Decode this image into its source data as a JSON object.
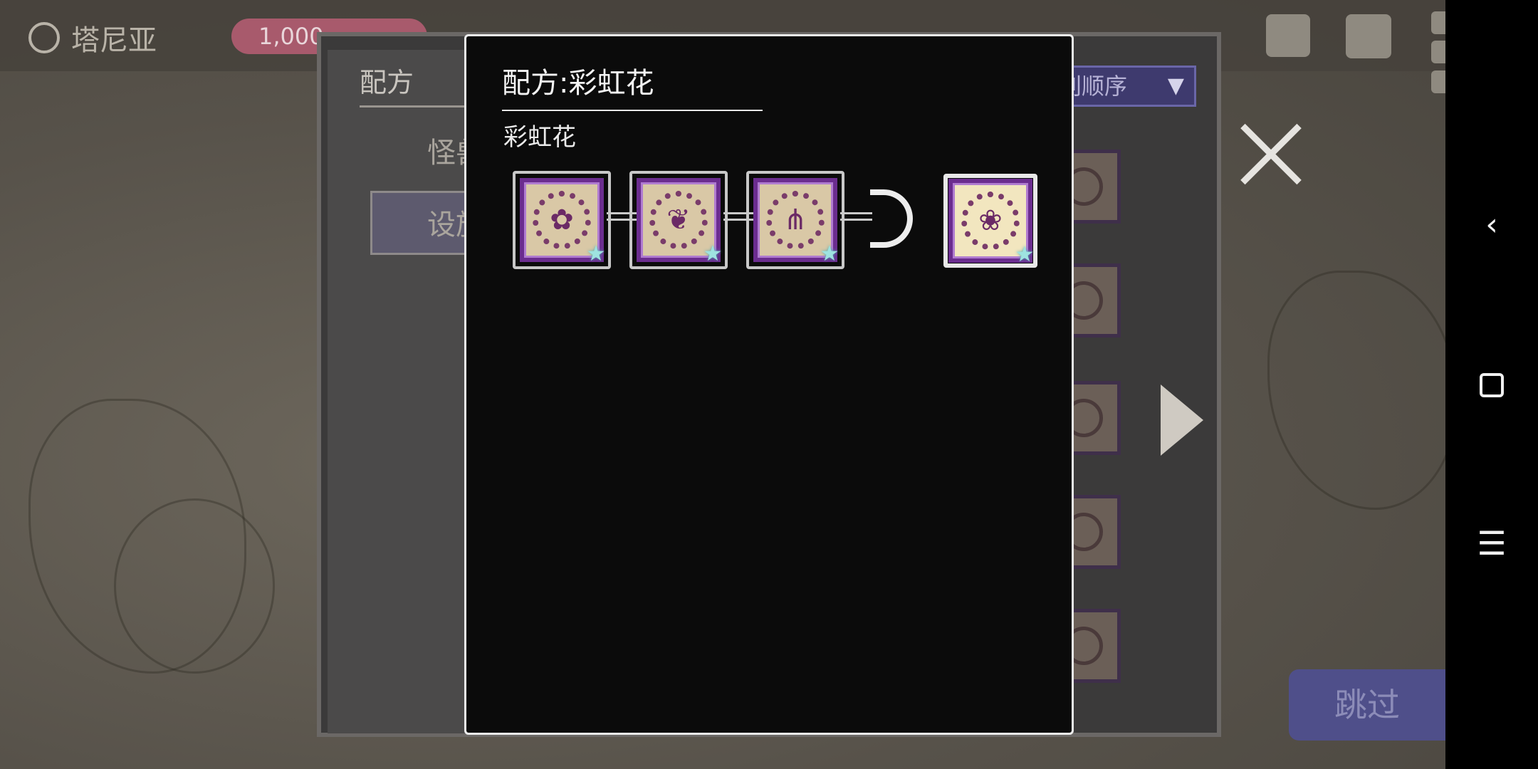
{
  "window": {
    "width": 2160,
    "height": 1080
  },
  "topbar": {
    "town_name": "塔尼亚",
    "gold": "1,000",
    "town_icon": "cauldron-icon",
    "icons": [
      "book-icon",
      "document-icon",
      "grid-menu-icon"
    ]
  },
  "book": {
    "tab_title": "配方",
    "tabs": [
      {
        "label": "怪兽",
        "selected": false
      },
      {
        "label": "设施",
        "selected": true
      }
    ],
    "sort_label": "按级别顺序",
    "sort_icon": "sort-icon",
    "sort_arrow": "▼",
    "skip_label": "跳过",
    "close_icon": "close-icon"
  },
  "modal": {
    "title": "配方:彩虹花",
    "subtitle": "彩虹花",
    "ingredients": [
      {
        "icon": "flower-icon",
        "glyph": "✿"
      },
      {
        "icon": "leaf-icon",
        "glyph": "❦"
      },
      {
        "icon": "grass-icon",
        "glyph": "⋔"
      }
    ],
    "result": {
      "icon": "rainbow-flower-icon",
      "glyph": "❀"
    },
    "star_badge": "★",
    "arrow_icon": "chain-arrow-icon"
  },
  "navbar": {
    "back": "‹",
    "menu": "☰"
  },
  "colors": {
    "modal_bg": "#0b0b0b",
    "slot_border": "#6b2d8f",
    "slot_fill": "#d9c8a6",
    "star": "#9ee3e0"
  }
}
